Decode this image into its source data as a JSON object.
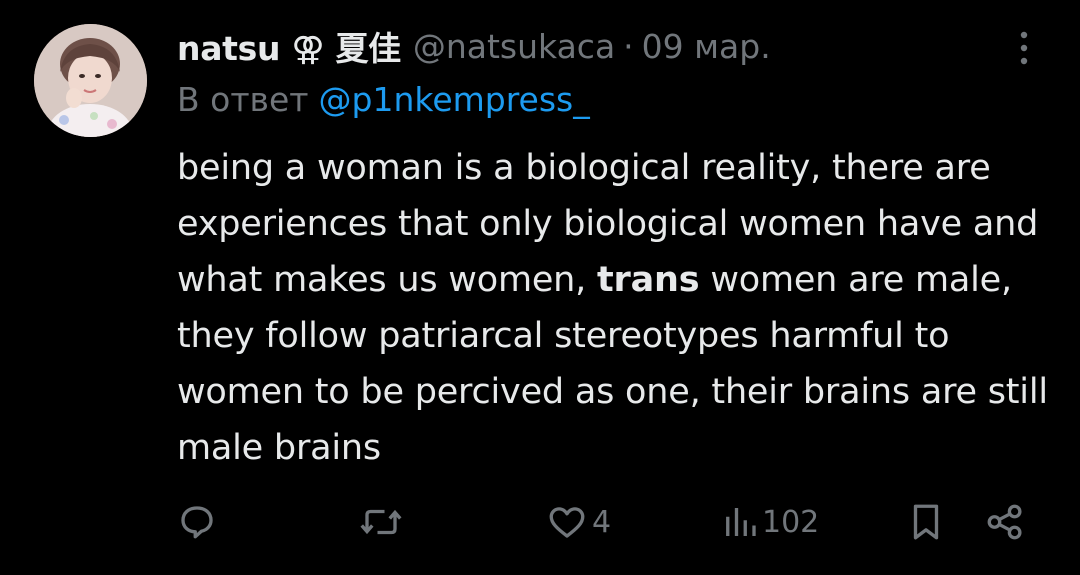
{
  "tweet": {
    "author_name": "natsu",
    "author_symbol": "⚢",
    "author_suffix": "夏佳",
    "handle": "@natsukaca",
    "separator": "·",
    "date": "09 мар.",
    "reply_prefix": "В ответ",
    "reply_to": "@p1nkempress_",
    "text_before_bold": "being a woman is a biological reality, there are experiences that only biological women have and what makes us women, ",
    "text_bold": "trans",
    "text_after_bold": " women are male, they follow patriarcal stereotypes harmful to women to be percived as one, their brains are still male brains"
  },
  "actions": {
    "replies_icon": "reply-bubble-icon",
    "retweet_icon": "retweet-icon",
    "likes_icon": "heart-icon",
    "likes_count": "4",
    "views_icon": "views-bar-icon",
    "views_count": "102",
    "bookmark_icon": "bookmark-icon",
    "share_icon": "share-icon"
  },
  "colors": {
    "background": "#000000",
    "text_primary": "#e7e9ea",
    "text_secondary": "#71767b",
    "link": "#1d9bf0"
  }
}
